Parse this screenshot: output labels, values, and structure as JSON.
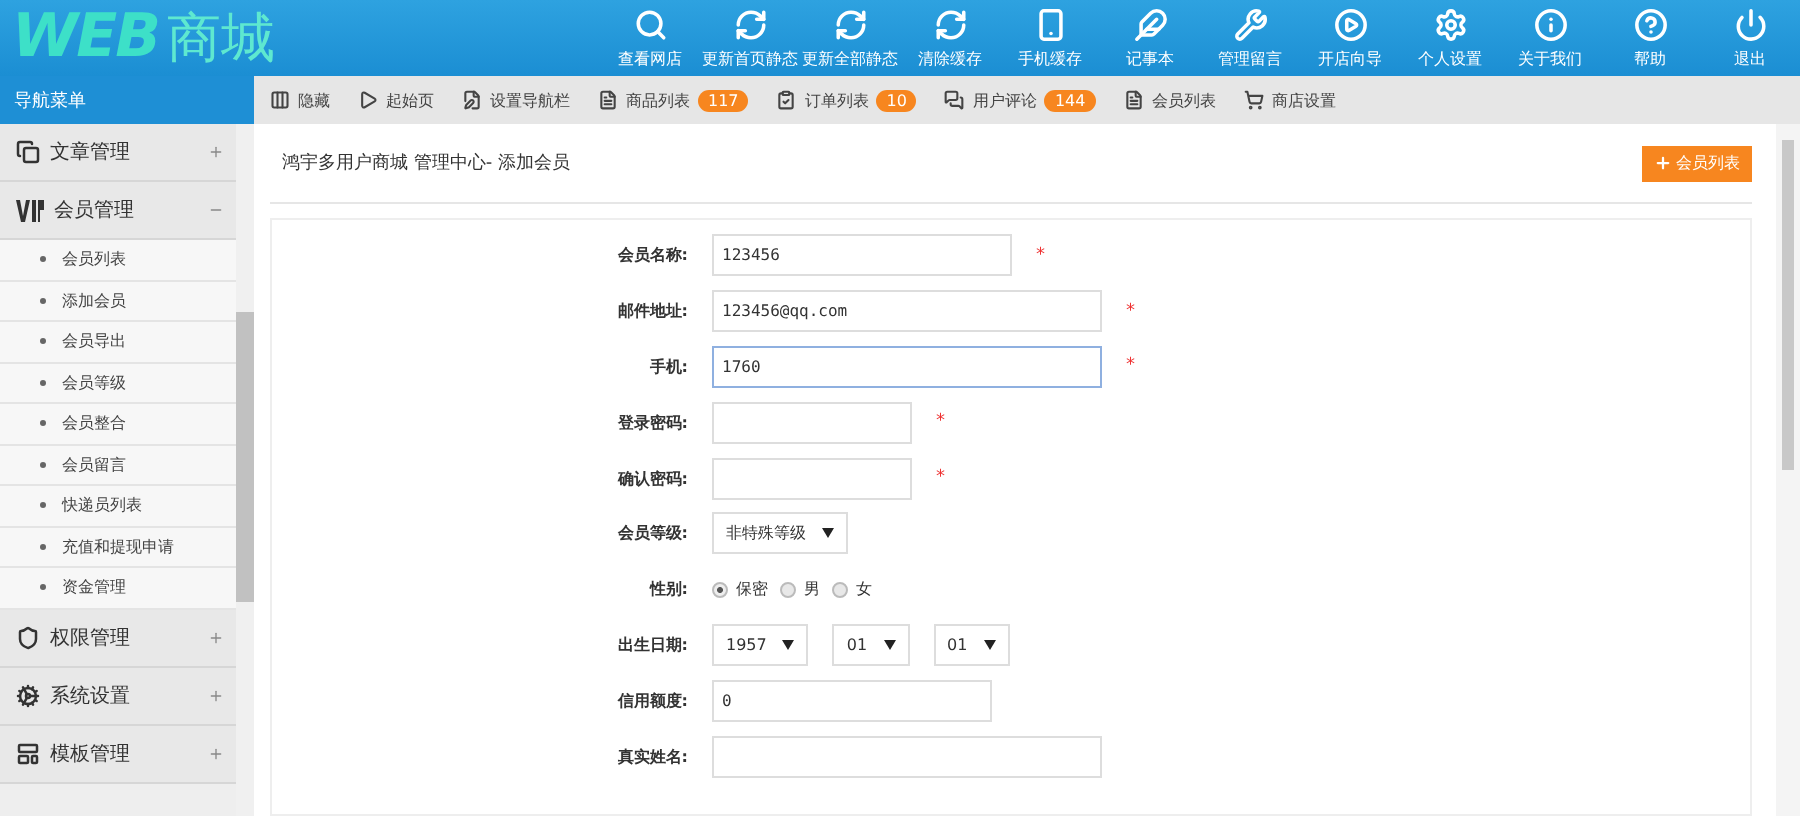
{
  "logo": {
    "latin": "WEB",
    "cjk": "商城"
  },
  "top_nav": [
    {
      "label": "查看网店"
    },
    {
      "label": "更新首页静态"
    },
    {
      "label": "更新全部静态"
    },
    {
      "label": "清除缓存"
    },
    {
      "label": "手机缓存"
    },
    {
      "label": "记事本"
    },
    {
      "label": "管理留言"
    },
    {
      "label": "开店向导"
    },
    {
      "label": "个人设置"
    },
    {
      "label": "关于我们"
    },
    {
      "label": "帮助"
    },
    {
      "label": "退出"
    }
  ],
  "sidebar": {
    "title": "导航菜单",
    "groups": [
      {
        "label": "文章管理",
        "expanded": false
      },
      {
        "label": "会员管理",
        "expanded": true,
        "children": [
          {
            "label": "会员列表"
          },
          {
            "label": "添加会员"
          },
          {
            "label": "会员导出"
          },
          {
            "label": "会员等级"
          },
          {
            "label": "会员整合"
          },
          {
            "label": "会员留言"
          },
          {
            "label": "快递员列表"
          },
          {
            "label": "充值和提现申请"
          },
          {
            "label": "资金管理"
          }
        ]
      },
      {
        "label": "权限管理",
        "expanded": false
      },
      {
        "label": "系统设置",
        "expanded": false
      },
      {
        "label": "模板管理",
        "expanded": false
      }
    ]
  },
  "toolbar": [
    {
      "label": "隐藏"
    },
    {
      "label": "起始页"
    },
    {
      "label": "设置导航栏"
    },
    {
      "label": "商品列表",
      "badge": "117"
    },
    {
      "label": "订单列表",
      "badge": "10"
    },
    {
      "label": "用户评论",
      "badge": "144"
    },
    {
      "label": "会员列表"
    },
    {
      "label": "商店设置"
    }
  ],
  "page": {
    "breadcrumb": "鸿宇多用户商城 管理中心- 添加会员",
    "action_button": "会员列表"
  },
  "form": [
    {
      "kind": "text",
      "label": "会员名称:",
      "value": "123456",
      "required": "*",
      "focused": false
    },
    {
      "kind": "text",
      "label": "邮件地址:",
      "value": "123456@qq.com",
      "required": "*",
      "focused": false
    },
    {
      "kind": "text",
      "label": "手机:",
      "value": "1760",
      "required": "*",
      "focused": true
    },
    {
      "kind": "text",
      "label": "登录密码:",
      "required": "*",
      "focused": false
    },
    {
      "kind": "text",
      "label": "确认密码:",
      "required": "*",
      "focused": false
    },
    {
      "kind": "select",
      "label": "会员等级:",
      "selects": [
        "非特殊等级"
      ]
    },
    {
      "kind": "radio",
      "label": "性别:",
      "options": [
        {
          "label": "保密",
          "selected": true
        },
        {
          "label": "男",
          "selected": false
        },
        {
          "label": "女",
          "selected": false
        }
      ]
    },
    {
      "kind": "select",
      "label": "出生日期:",
      "selects": [
        "1957",
        "01",
        "01"
      ]
    },
    {
      "kind": "text",
      "label": "信用额度:",
      "value": "0",
      "focused": false
    },
    {
      "kind": "text",
      "label": "真实姓名:",
      "focused": false
    }
  ]
}
